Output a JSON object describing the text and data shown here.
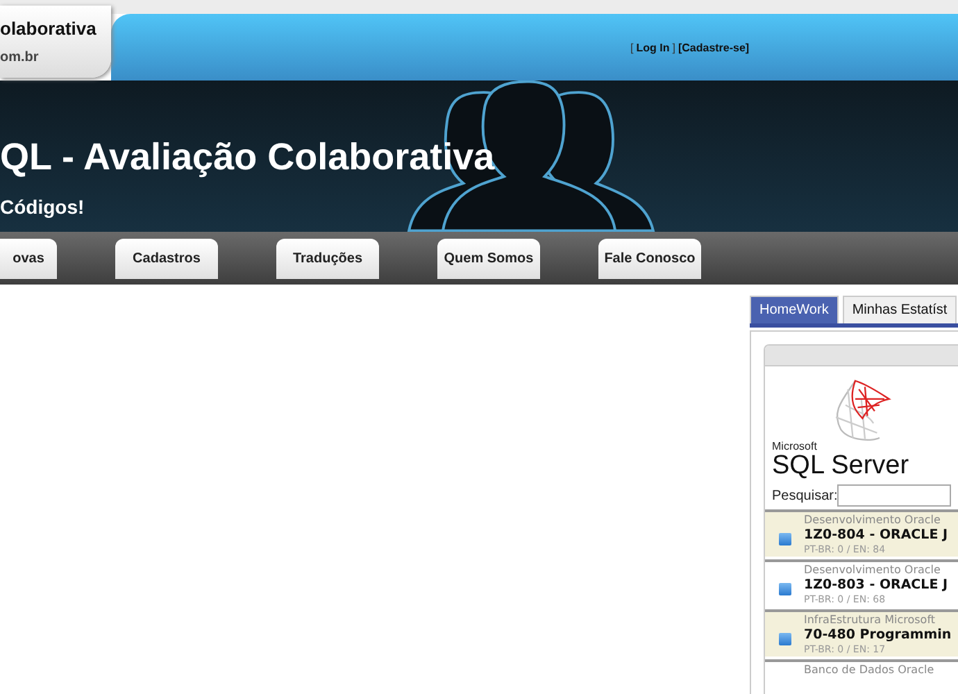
{
  "header": {
    "site_name": "olaborativa",
    "site_domain": "om.br",
    "auth_links": [
      {
        "kind": "bracket",
        "label": "["
      },
      {
        "kind": "link",
        "label": "Log In"
      },
      {
        "kind": "bracket",
        "label": "]"
      },
      {
        "kind": "link",
        "label": "[Cadastre-se]"
      }
    ]
  },
  "banner": {
    "title": "QL - Avaliação Colaborativa",
    "subtitle": "Códigos!"
  },
  "nav": [
    "ovas",
    "Cadastros",
    "Traduções",
    "Quem Somos",
    "Fale Conosco"
  ],
  "panel": {
    "tabs": [
      {
        "label": "HomeWork",
        "selected": true
      },
      {
        "label": "Minhas Estatíst",
        "selected": false
      }
    ],
    "logo": {
      "brand": "Microsoft",
      "product": "SQL Server"
    },
    "search": {
      "label": "Pesquisar:"
    },
    "items": [
      {
        "category": "Desenvolvimento Oracle",
        "title": "1Z0-804 - ORACLE J",
        "counts": "PT-BR: 0 / EN: 84",
        "highlighted": true
      },
      {
        "category": "Desenvolvimento Oracle",
        "title": "1Z0-803 - ORACLE J",
        "counts": "PT-BR: 0 / EN: 68",
        "highlighted": false
      },
      {
        "category": "InfraEstrutura Microsoft",
        "title": "70-480 Programmin",
        "counts": "PT-BR: 0 / EN: 17",
        "highlighted": true
      },
      {
        "category": "Banco de Dados Oracle",
        "highlighted": false
      }
    ]
  }
}
